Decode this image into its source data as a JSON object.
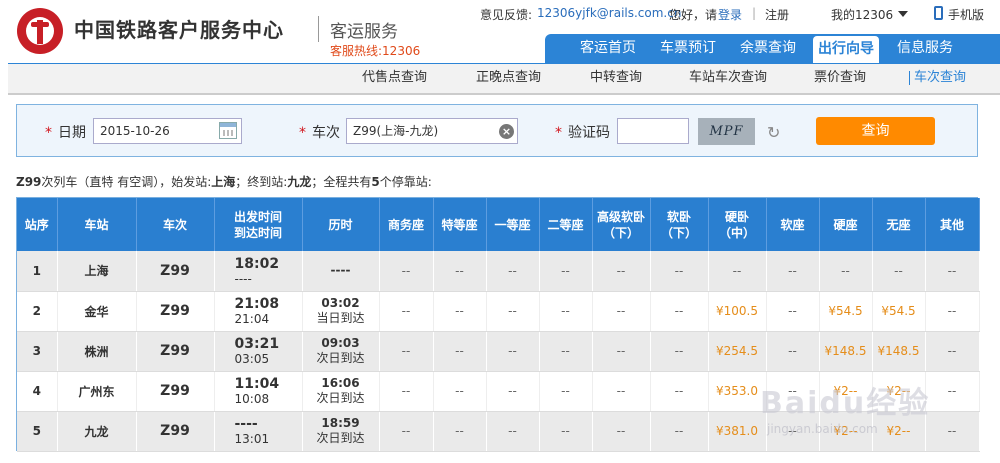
{
  "header": {
    "brand": "中国铁路客户服务中心",
    "sub": "客运服务",
    "hotline": "客服热线:12306",
    "feedback_label": "意见反馈:",
    "feedback_email": "12306yjfk@rails.com.cn",
    "greeting": "您好，请",
    "login": "登录",
    "divider": "|",
    "register": "注册",
    "my12306": "我的12306",
    "mobile": "手机版"
  },
  "mainnav": [
    {
      "label": "客运首页"
    },
    {
      "label": "车票预订"
    },
    {
      "label": "余票查询"
    },
    {
      "label": "出行向导",
      "active": true
    },
    {
      "label": "信息服务"
    }
  ],
  "subnav": [
    {
      "label": "代售点查询"
    },
    {
      "label": "正晚点查询"
    },
    {
      "label": "中转查询"
    },
    {
      "label": "车站车次查询"
    },
    {
      "label": "票价查询"
    },
    {
      "label": "车次查询",
      "active": true
    }
  ],
  "query": {
    "date_label": "日期",
    "date_value": "2015-10-26",
    "train_label": "车次",
    "train_value": "Z99(上海-九龙)",
    "captcha_label": "验证码",
    "captcha_value": "",
    "captcha_text": "MPF",
    "button": "查询",
    "star": "*"
  },
  "summary": {
    "train": "Z99",
    "part1": "次列车（直特 有空调），始发站:",
    "origin": "上海",
    "part2": "；终到站:",
    "dest": "九龙",
    "part3": "；全程共有",
    "count": "5",
    "part4": "个停靠站:"
  },
  "table": {
    "headers": [
      "站序",
      "车站",
      "车次",
      "出发时间\n到达时间",
      "历时",
      "商务座",
      "特等座",
      "一等座",
      "二等座",
      "高级软卧\n（下）",
      "软卧\n（下）",
      "硬卧\n（中）",
      "软座",
      "硬座",
      "无座",
      "其他"
    ],
    "rows": [
      {
        "seq": "1",
        "station": "上海",
        "train": "Z99",
        "dep": "18:02",
        "arr": "----",
        "dur": "----",
        "dur_note": "",
        "seats": [
          "--",
          "--",
          "--",
          "--",
          "--",
          "--",
          "--",
          "--",
          "--",
          "--",
          "--"
        ]
      },
      {
        "seq": "2",
        "station": "金华",
        "train": "Z99",
        "dep": "21:08",
        "arr": "21:04",
        "dur": "03:02",
        "dur_note": "当日到达",
        "seats": [
          "--",
          "--",
          "--",
          "--",
          "--",
          "--",
          "¥100.5",
          "--",
          "¥54.5",
          "¥54.5",
          "--"
        ]
      },
      {
        "seq": "3",
        "station": "株洲",
        "train": "Z99",
        "dep": "03:21",
        "arr": "03:05",
        "dur": "09:03",
        "dur_note": "次日到达",
        "seats": [
          "--",
          "--",
          "--",
          "--",
          "--",
          "--",
          "¥254.5",
          "--",
          "¥148.5",
          "¥148.5",
          "--"
        ]
      },
      {
        "seq": "4",
        "station": "广州东",
        "train": "Z99",
        "dep": "11:04",
        "arr": "10:08",
        "dur": "16:06",
        "dur_note": "次日到达",
        "seats": [
          "--",
          "--",
          "--",
          "--",
          "--",
          "--",
          "¥353.0",
          "--",
          "¥2--",
          "¥2--",
          "--"
        ]
      },
      {
        "seq": "5",
        "station": "九龙",
        "train": "Z99",
        "dep": "----",
        "arr": "13:01",
        "dur": "18:59",
        "dur_note": "次日到达",
        "seats": [
          "--",
          "--",
          "--",
          "--",
          "--",
          "--",
          "¥381.0",
          "--",
          "¥2--",
          "¥2--",
          "--"
        ]
      }
    ]
  },
  "watermark": "Baidu经验",
  "watermark_url": "jingyan.baidu.com"
}
